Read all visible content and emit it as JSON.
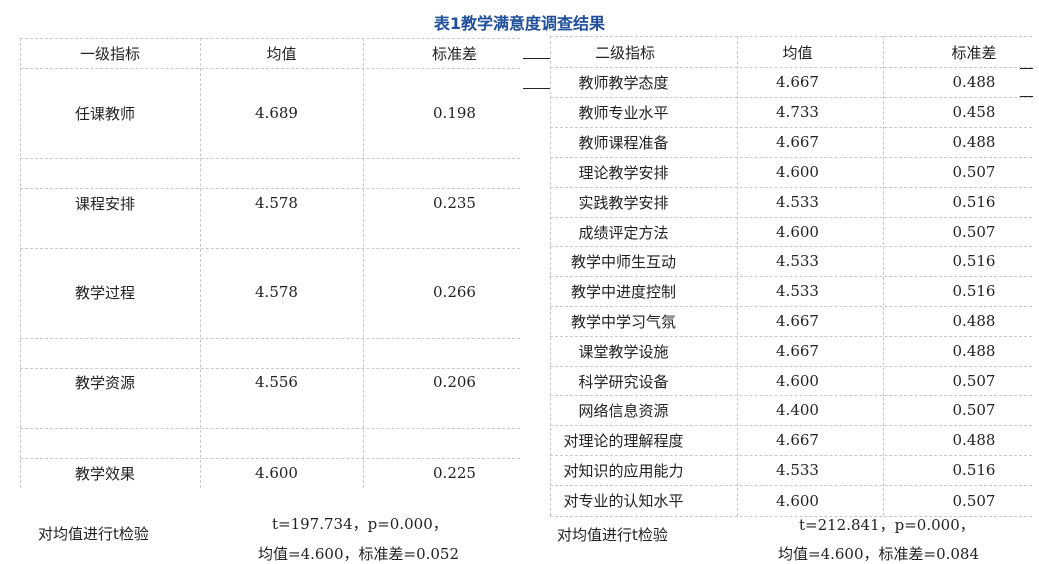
{
  "title": "表1教学满意度调查结果",
  "left_table": {
    "headers": [
      "一级指标",
      "均值",
      "标准差"
    ],
    "rows": [
      {
        "name": "任课教师",
        "mean": "4.689",
        "sd": "0.198"
      },
      {
        "name": "课程安排",
        "mean": "4.578",
        "sd": "0.235"
      },
      {
        "name": "教学过程",
        "mean": "4.578",
        "sd": "0.266"
      },
      {
        "name": "教学资源",
        "mean": "4.556",
        "sd": "0.206"
      },
      {
        "name": "教学效果",
        "mean": "4.600",
        "sd": "0.225"
      }
    ],
    "ttest_label": "对均值进行t检验",
    "ttest_line1": "t=197.734，p=0.000，",
    "ttest_line2": "均值=4.600，标准差=0.052"
  },
  "right_table": {
    "headers": [
      "二级指标",
      "均值",
      "标准差"
    ],
    "rows": [
      {
        "name": "教师教学态度",
        "mean": "4.667",
        "sd": "0.488"
      },
      {
        "name": "教师专业水平",
        "mean": "4.733",
        "sd": "0.458"
      },
      {
        "name": "教师课程准备",
        "mean": "4.667",
        "sd": "0.488"
      },
      {
        "name": "理论教学安排",
        "mean": "4.600",
        "sd": "0.507"
      },
      {
        "name": "实践教学安排",
        "mean": "4.533",
        "sd": "0.516"
      },
      {
        "name": "成绩评定方法",
        "mean": "4.600",
        "sd": "0.507"
      },
      {
        "name": "教学中师生互动",
        "mean": "4.533",
        "sd": "0.516"
      },
      {
        "name": "教学中进度控制",
        "mean": "4.533",
        "sd": "0.516"
      },
      {
        "name": "教学中学习气氛",
        "mean": "4.667",
        "sd": "0.488"
      },
      {
        "name": "课堂教学设施",
        "mean": "4.667",
        "sd": "0.488"
      },
      {
        "name": "科学研究设备",
        "mean": "4.600",
        "sd": "0.507"
      },
      {
        "name": "网络信息资源",
        "mean": "4.400",
        "sd": "0.507"
      },
      {
        "name": "对理论的理解程度",
        "mean": "4.667",
        "sd": "0.488"
      },
      {
        "name": "对知识的应用能力",
        "mean": "4.533",
        "sd": "0.516"
      },
      {
        "name": "对专业的认知水平",
        "mean": "4.600",
        "sd": "0.507"
      }
    ],
    "ttest_label": "对均值进行t检验",
    "ttest_line1": "t=212.841，p=0.000，",
    "ttest_line2": "均值=4.600，标准差=0.084"
  }
}
